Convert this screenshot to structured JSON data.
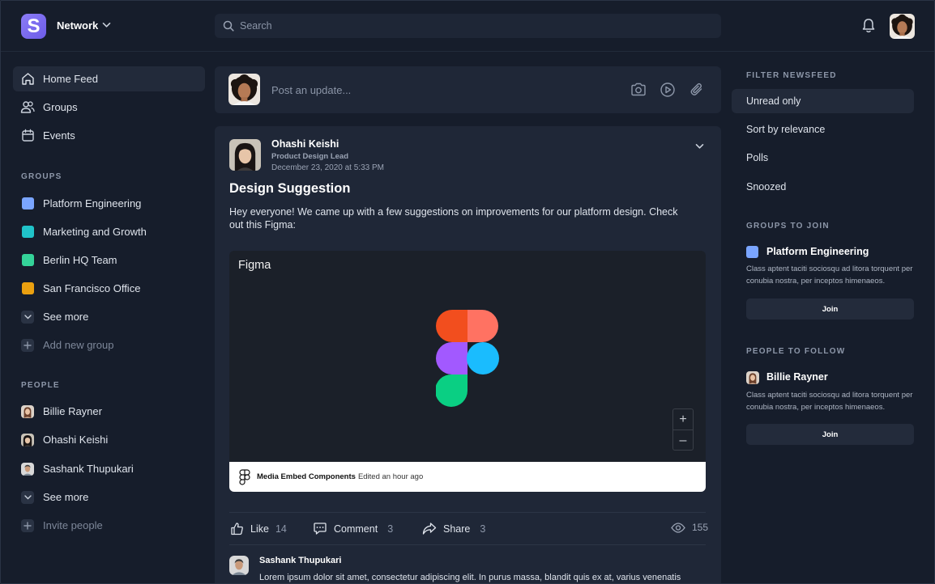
{
  "header": {
    "logo_letter": "S",
    "workspace_name": "Network",
    "search_placeholder": "Search"
  },
  "sidebar": {
    "nav": [
      {
        "label": "Home Feed",
        "icon": "home-icon",
        "active": true
      },
      {
        "label": "Groups",
        "icon": "users-icon",
        "active": false
      },
      {
        "label": "Events",
        "icon": "calendar-icon",
        "active": false
      }
    ],
    "groups_title": "GROUPS",
    "groups": [
      {
        "label": "Platform Engineering",
        "color": "#7aa5ff"
      },
      {
        "label": "Marketing and Growth",
        "color": "#20c3c9"
      },
      {
        "label": "Berlin HQ Team",
        "color": "#34d399"
      },
      {
        "label": "San Francisco Office",
        "color": "#eaa010"
      }
    ],
    "groups_see_more": "See more",
    "add_group": "Add new group",
    "people_title": "PEOPLE",
    "people": [
      {
        "label": "Billie Rayner"
      },
      {
        "label": "Ohashi Keishi"
      },
      {
        "label": "Sashank Thupukari"
      }
    ],
    "people_see_more": "See more",
    "invite": "Invite people"
  },
  "composer": {
    "placeholder": "Post an update..."
  },
  "post": {
    "author": "Ohashi Keishi",
    "role": "Product Design Lead",
    "date": "December 23, 2020 at 5:33 PM",
    "title": "Design Suggestion",
    "body": "Hey everyone! We came up with a few suggestions on improvements for our platform design. Check out this Figma:",
    "embed": {
      "title": "Figma",
      "file_name": "Media Embed Components",
      "edited": "Edited an hour ago",
      "zoom_in": "+",
      "zoom_out": "–"
    },
    "stats": {
      "like_label": "Like",
      "like_count": "14",
      "comment_label": "Comment",
      "comment_count": "3",
      "share_label": "Share",
      "share_count": "3",
      "views": "155"
    },
    "comment": {
      "author": "Sashank Thupukari",
      "text": "Lorem ipsum dolor sit amet, consectetur adipiscing elit. In purus massa, blandit quis ex at, varius venenatis"
    }
  },
  "right": {
    "filter_title": "FILTER NEWSFEED",
    "filters": [
      {
        "label": "Unread only",
        "active": true
      },
      {
        "label": "Sort by relevance",
        "active": false
      },
      {
        "label": "Polls",
        "active": false
      },
      {
        "label": "Snoozed",
        "active": false
      }
    ],
    "groups_to_join_title": "GROUPS TO JOIN",
    "group_suggestion": {
      "name": "Platform Engineering",
      "color": "#7aa5ff",
      "description": "Class aptent taciti sociosqu ad litora torquent per conubia nostra, per inceptos himenaeos.",
      "button": "Join"
    },
    "people_to_follow_title": "PEOPLE TO FOLLOW",
    "person_suggestion": {
      "name": "Billie Rayner",
      "description": "Class aptent taciti sociosqu ad litora torquent per conubia nostra, per inceptos himenaeos.",
      "button": "Join"
    }
  }
}
